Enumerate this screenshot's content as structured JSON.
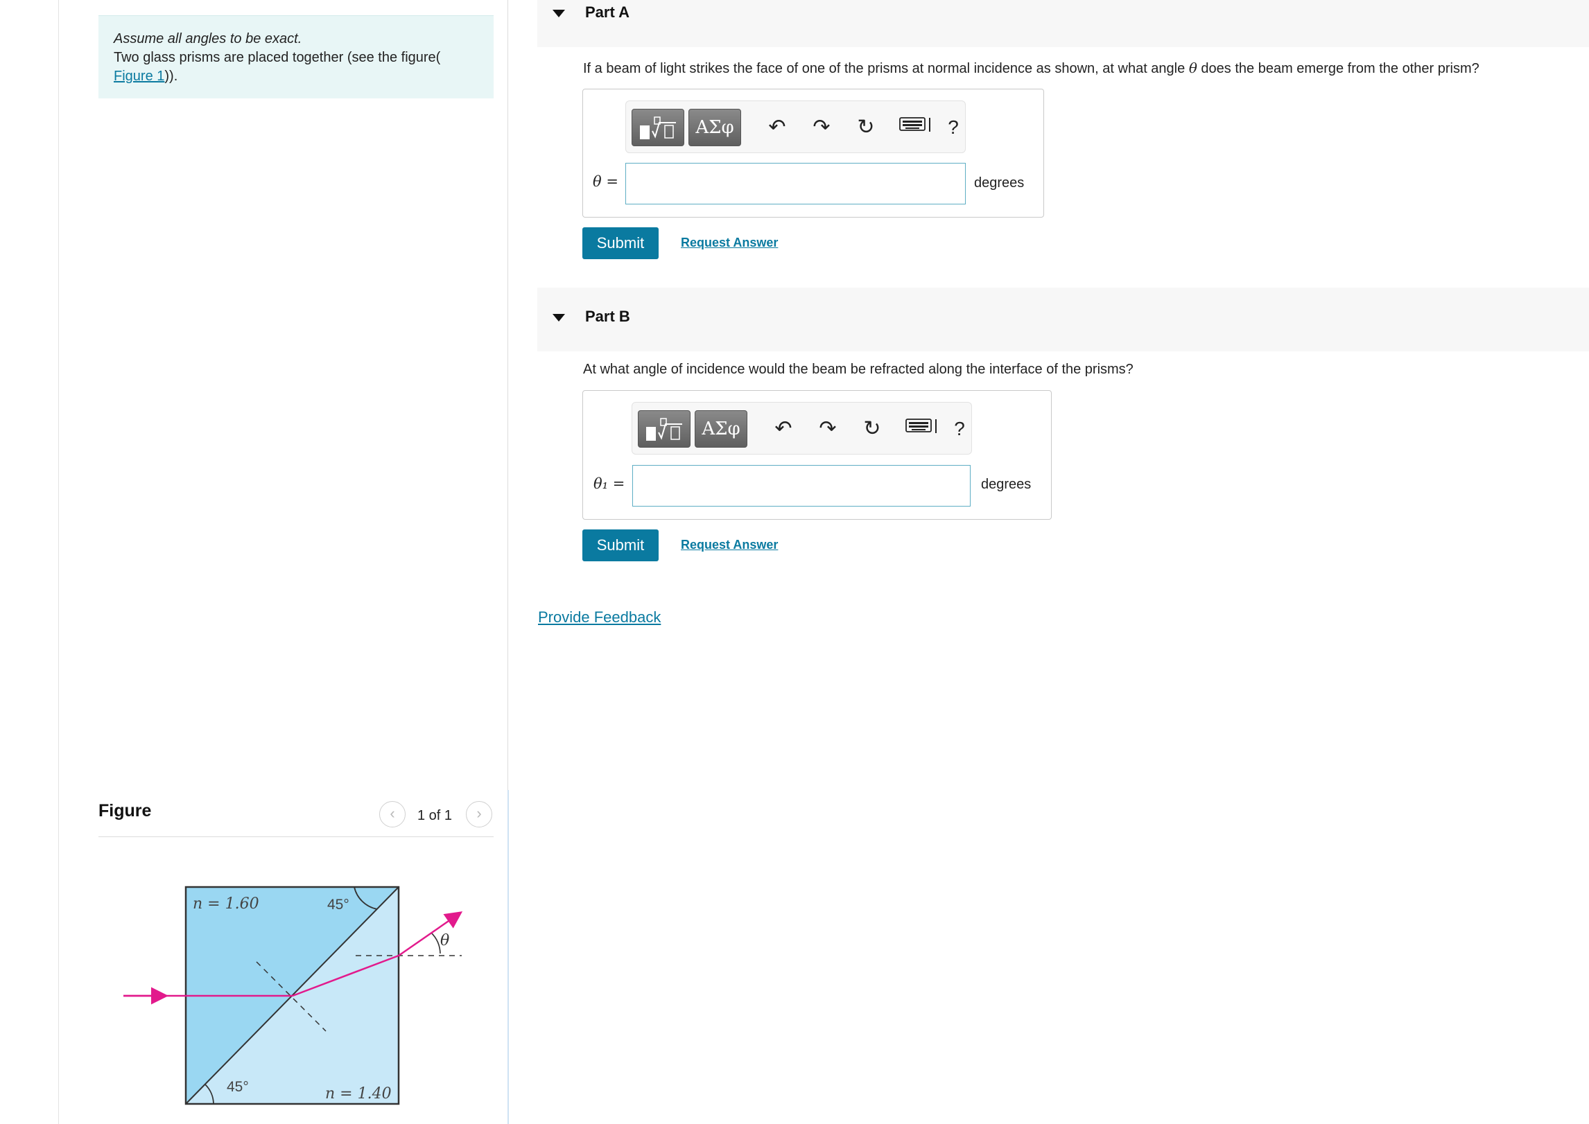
{
  "intro": {
    "note": "Assume all angles to be exact.",
    "text_before": "Two glass prisms are placed together (see the figure(",
    "link": "Figure 1",
    "text_after": "))."
  },
  "figure": {
    "title": "Figure",
    "pager": "1 of 1",
    "labels": {
      "n_top": "n = 1.60",
      "angle_top": "45°",
      "angle_bottom": "45°",
      "n_bottom": "n = 1.40",
      "theta": "θ"
    },
    "colors": {
      "prism_upper": "#9ad7f2",
      "prism_lower": "#c8e8f8",
      "beam": "#e21a8c",
      "outline": "#333333"
    }
  },
  "parts": {
    "a": {
      "title": "Part A",
      "question_before": "If a beam of light strikes the face of one of the prisms at normal incidence as shown, at what angle ",
      "question_symbol": "θ",
      "question_after": " does the beam emerge from the other prism?",
      "var_label": "θ =",
      "input_value": "",
      "unit": "degrees",
      "submit": "Submit",
      "request": "Request Answer"
    },
    "b": {
      "title": "Part B",
      "question": "At what angle of incidence would the beam be refracted along the interface of the prisms?",
      "var_label": "θ₁ =",
      "input_value": "",
      "unit": "degrees",
      "submit": "Submit",
      "request": "Request Answer"
    }
  },
  "toolbar": {
    "templates_icon": "templates-icon",
    "greek_label": "ΑΣφ",
    "undo_icon": "undo-icon",
    "redo_icon": "redo-icon",
    "reset_icon": "reset-icon",
    "keyboard_icon": "keyboard-icon",
    "help_label": "?"
  },
  "feedback": "Provide Feedback",
  "theme": {
    "accent": "#0a7aa0",
    "intro_bg": "#e8f6f6",
    "header_bg": "#f7f7f7"
  }
}
